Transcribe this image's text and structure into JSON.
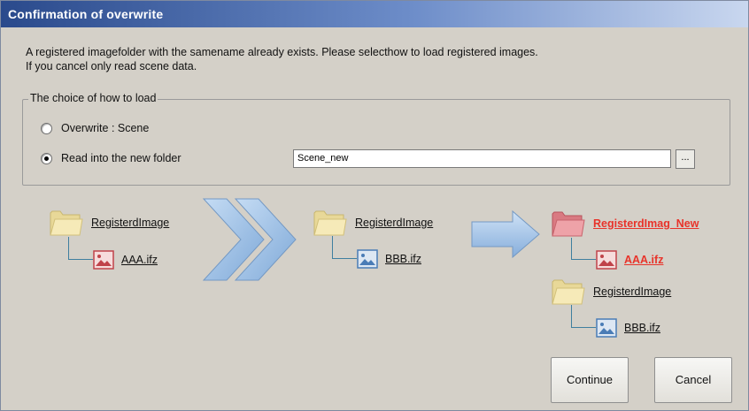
{
  "window": {
    "title": "Confirmation of overwrite"
  },
  "message": {
    "line1": "A registered imagefolder with the samename already exists. Please selecthow to load registered images.",
    "line2": "If you cancel only read scene data."
  },
  "load_group": {
    "legend": "The choice of how to load",
    "option_overwrite": {
      "label": "Overwrite : Scene",
      "selected": false
    },
    "option_new_folder": {
      "label": "Read into the new folder",
      "selected": true
    },
    "folder_name_value": "Scene_new",
    "browse_label": "..."
  },
  "diagram": {
    "step1": {
      "folder": "RegisterdImage",
      "file": "AAA.ifz"
    },
    "step2": {
      "folder": "RegisterdImage",
      "file": "BBB.ifz"
    },
    "result": {
      "new_folder": "RegisterdImag_New",
      "new_file": "AAA.ifz",
      "folder": "RegisterdImage",
      "file": "BBB.ifz"
    }
  },
  "buttons": {
    "continue_label": "Continue",
    "cancel_label": "Cancel"
  }
}
